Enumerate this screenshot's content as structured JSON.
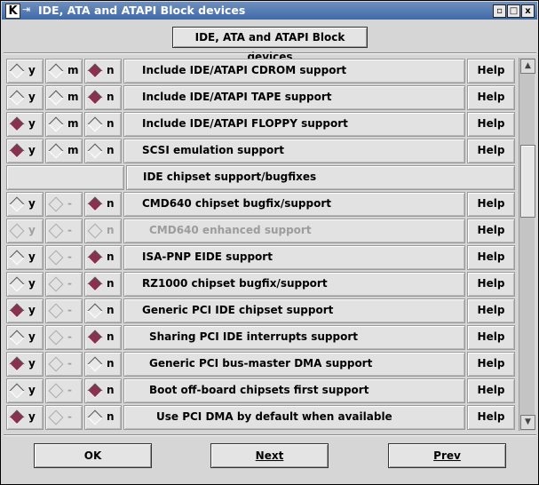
{
  "window": {
    "title": "IDE, ATA and ATAPI Block devices",
    "app_icon": "K",
    "pin_icon": "⇥",
    "controls": [
      "▫",
      "□",
      "x"
    ]
  },
  "header_button": "IDE, ATA and ATAPI Block devices",
  "rows": [
    {
      "kind": "option",
      "y": "y",
      "m": "m",
      "n": "n",
      "selected": "n",
      "tristate": true,
      "disabled": false,
      "indent": 0,
      "label": "Include IDE/ATAPI CDROM support",
      "help": "Help"
    },
    {
      "kind": "option",
      "y": "y",
      "m": "m",
      "n": "n",
      "selected": "n",
      "tristate": true,
      "disabled": false,
      "indent": 0,
      "label": "Include IDE/ATAPI TAPE support",
      "help": "Help"
    },
    {
      "kind": "option",
      "y": "y",
      "m": "m",
      "n": "n",
      "selected": "y",
      "tristate": true,
      "disabled": false,
      "indent": 0,
      "label": "Include IDE/ATAPI FLOPPY support",
      "help": "Help"
    },
    {
      "kind": "option",
      "y": "y",
      "m": "m",
      "n": "n",
      "selected": "y",
      "tristate": true,
      "disabled": false,
      "indent": 0,
      "label": "SCSI emulation support",
      "help": "Help"
    },
    {
      "kind": "section",
      "label": "IDE chipset support/bugfixes"
    },
    {
      "kind": "option",
      "y": "y",
      "m": "-",
      "n": "n",
      "selected": "n",
      "tristate": false,
      "disabled": false,
      "indent": 0,
      "label": "CMD640 chipset bugfix/support",
      "help": "Help"
    },
    {
      "kind": "option",
      "y": "y",
      "m": "-",
      "n": "n",
      "selected": "",
      "tristate": false,
      "disabled": true,
      "indent": 1,
      "label": "CMD640 enhanced support",
      "help": "Help"
    },
    {
      "kind": "option",
      "y": "y",
      "m": "-",
      "n": "n",
      "selected": "n",
      "tristate": false,
      "disabled": false,
      "indent": 0,
      "label": "ISA-PNP EIDE support",
      "help": "Help"
    },
    {
      "kind": "option",
      "y": "y",
      "m": "-",
      "n": "n",
      "selected": "n",
      "tristate": false,
      "disabled": false,
      "indent": 0,
      "label": "RZ1000 chipset bugfix/support",
      "help": "Help"
    },
    {
      "kind": "option",
      "y": "y",
      "m": "-",
      "n": "n",
      "selected": "y",
      "tristate": false,
      "disabled": false,
      "indent": 0,
      "label": "Generic PCI IDE chipset support",
      "help": "Help"
    },
    {
      "kind": "option",
      "y": "y",
      "m": "-",
      "n": "n",
      "selected": "n",
      "tristate": false,
      "disabled": false,
      "indent": 1,
      "label": "Sharing PCI IDE interrupts support",
      "help": "Help"
    },
    {
      "kind": "option",
      "y": "y",
      "m": "-",
      "n": "n",
      "selected": "y",
      "tristate": false,
      "disabled": false,
      "indent": 1,
      "label": "Generic PCI bus-master DMA support",
      "help": "Help"
    },
    {
      "kind": "option",
      "y": "y",
      "m": "-",
      "n": "n",
      "selected": "n",
      "tristate": false,
      "disabled": false,
      "indent": 1,
      "label": "Boot off-board chipsets first support",
      "help": "Help"
    },
    {
      "kind": "option",
      "y": "y",
      "m": "-",
      "n": "n",
      "selected": "y",
      "tristate": false,
      "disabled": false,
      "indent": 2,
      "label": "Use PCI DMA by default when available",
      "help": "Help"
    }
  ],
  "scrollbar": {
    "up": "▲",
    "down": "▼"
  },
  "buttons": {
    "ok": "OK",
    "next": "Next",
    "prev": "Prev"
  },
  "colors": {
    "selected_radio": "#8a3050",
    "title_bar": "#3f6aa8"
  }
}
